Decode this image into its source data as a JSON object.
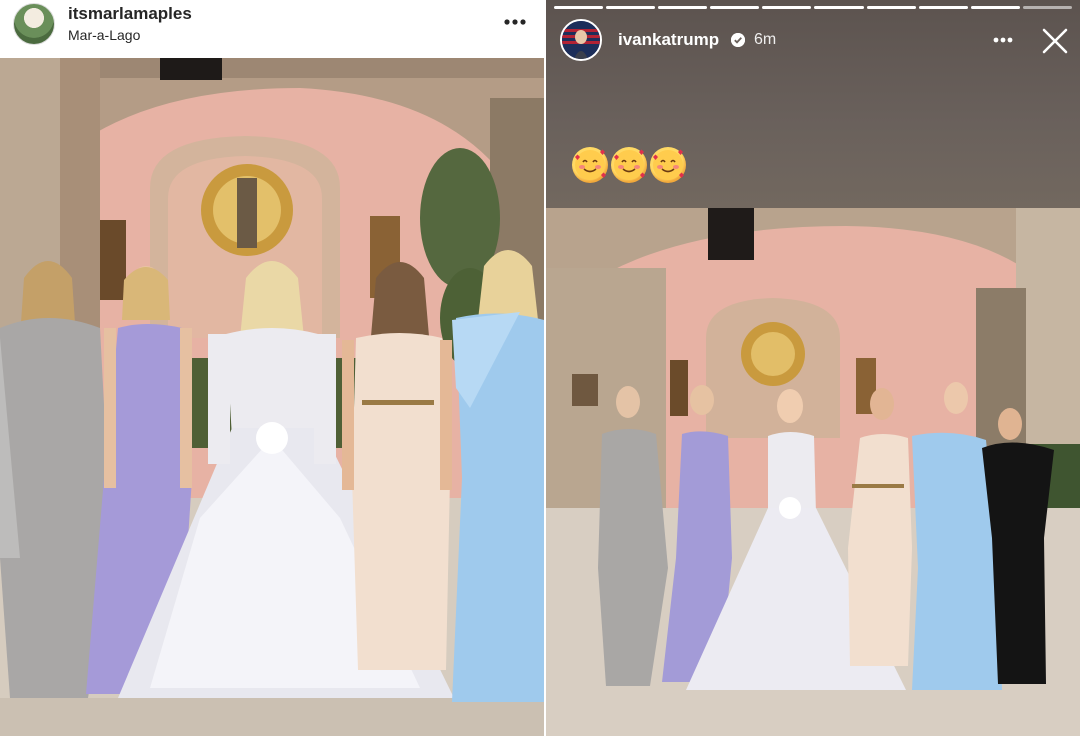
{
  "post": {
    "username": "itsmarlamaples",
    "location": "Mar-a-Lago",
    "more_icon": "more-horizontal-icon"
  },
  "story": {
    "username": "ivankatrump",
    "time_ago": "6m",
    "verified_icon": "verified-badge-icon",
    "more_icon": "more-horizontal-icon",
    "close_icon": "close-icon",
    "caption_emojis": [
      "🥰",
      "🥰",
      "🥰"
    ],
    "progress_segments": 10,
    "progress_active": 9
  },
  "colors": {
    "story_background": "#6f6560",
    "wall_pink": "#e9b3a8",
    "stone": "#c9b9a5"
  }
}
